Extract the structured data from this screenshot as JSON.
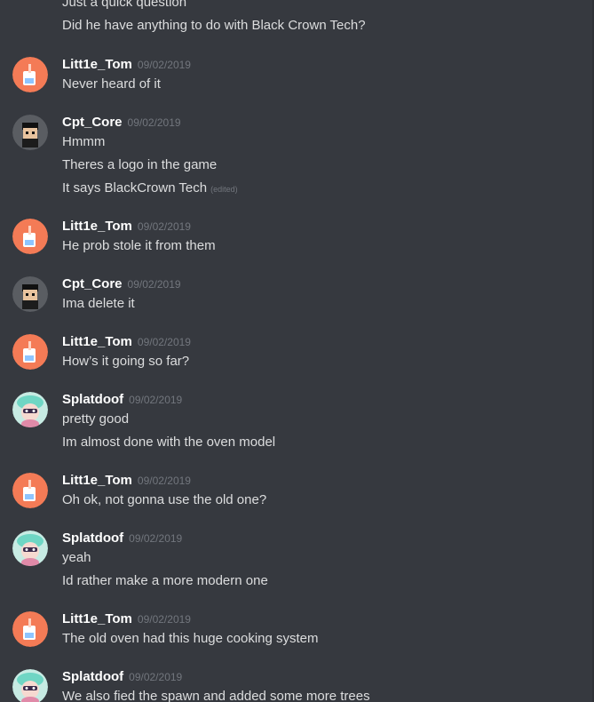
{
  "intro": {
    "line0": "Just a quick question",
    "line1": "Did he have anything to do with Black Crown Tech?"
  },
  "messages": [
    {
      "author": "Litt1e_Tom",
      "time": "09/02/2019",
      "lines": [
        "Never heard of it"
      ]
    },
    {
      "author": "Cpt_Core",
      "time": "09/02/2019",
      "lines": [
        "Hmmm",
        "Theres a logo in the game",
        "It says BlackCrown Tech"
      ],
      "edited": "(edited)"
    },
    {
      "author": "Litt1e_Tom",
      "time": "09/02/2019",
      "lines": [
        "He prob stole it from them"
      ]
    },
    {
      "author": "Cpt_Core",
      "time": "09/02/2019",
      "lines": [
        "Ima delete it"
      ]
    },
    {
      "author": "Litt1e_Tom",
      "time": "09/02/2019",
      "lines": [
        "How’s it going so far?"
      ]
    },
    {
      "author": "Splatdoof",
      "time": "09/02/2019",
      "lines": [
        "pretty good",
        "Im almost done with the oven model"
      ]
    },
    {
      "author": "Litt1e_Tom",
      "time": "09/02/2019",
      "lines": [
        "Oh ok, not gonna use the old one?"
      ]
    },
    {
      "author": "Splatdoof",
      "time": "09/02/2019",
      "lines": [
        "yeah",
        "Id rather make a more modern one"
      ]
    },
    {
      "author": "Litt1e_Tom",
      "time": "09/02/2019",
      "lines": [
        "The old oven had this huge cooking system"
      ]
    },
    {
      "author": "Splatdoof",
      "time": "09/02/2019",
      "lines": [
        "We also fied the spawn and added some more trees"
      ]
    }
  ],
  "avatars": {
    "Litt1e_Tom": "cup-drink-avatar",
    "Cpt_Core": "pixel-character-avatar",
    "Splatdoof": "inkling-character-avatar"
  },
  "colors": {
    "background": "#36393f",
    "username": "#ffffff",
    "text": "#dcddde",
    "timestamp": "#72767d",
    "tom_avatar_bg": "#f47b56"
  }
}
